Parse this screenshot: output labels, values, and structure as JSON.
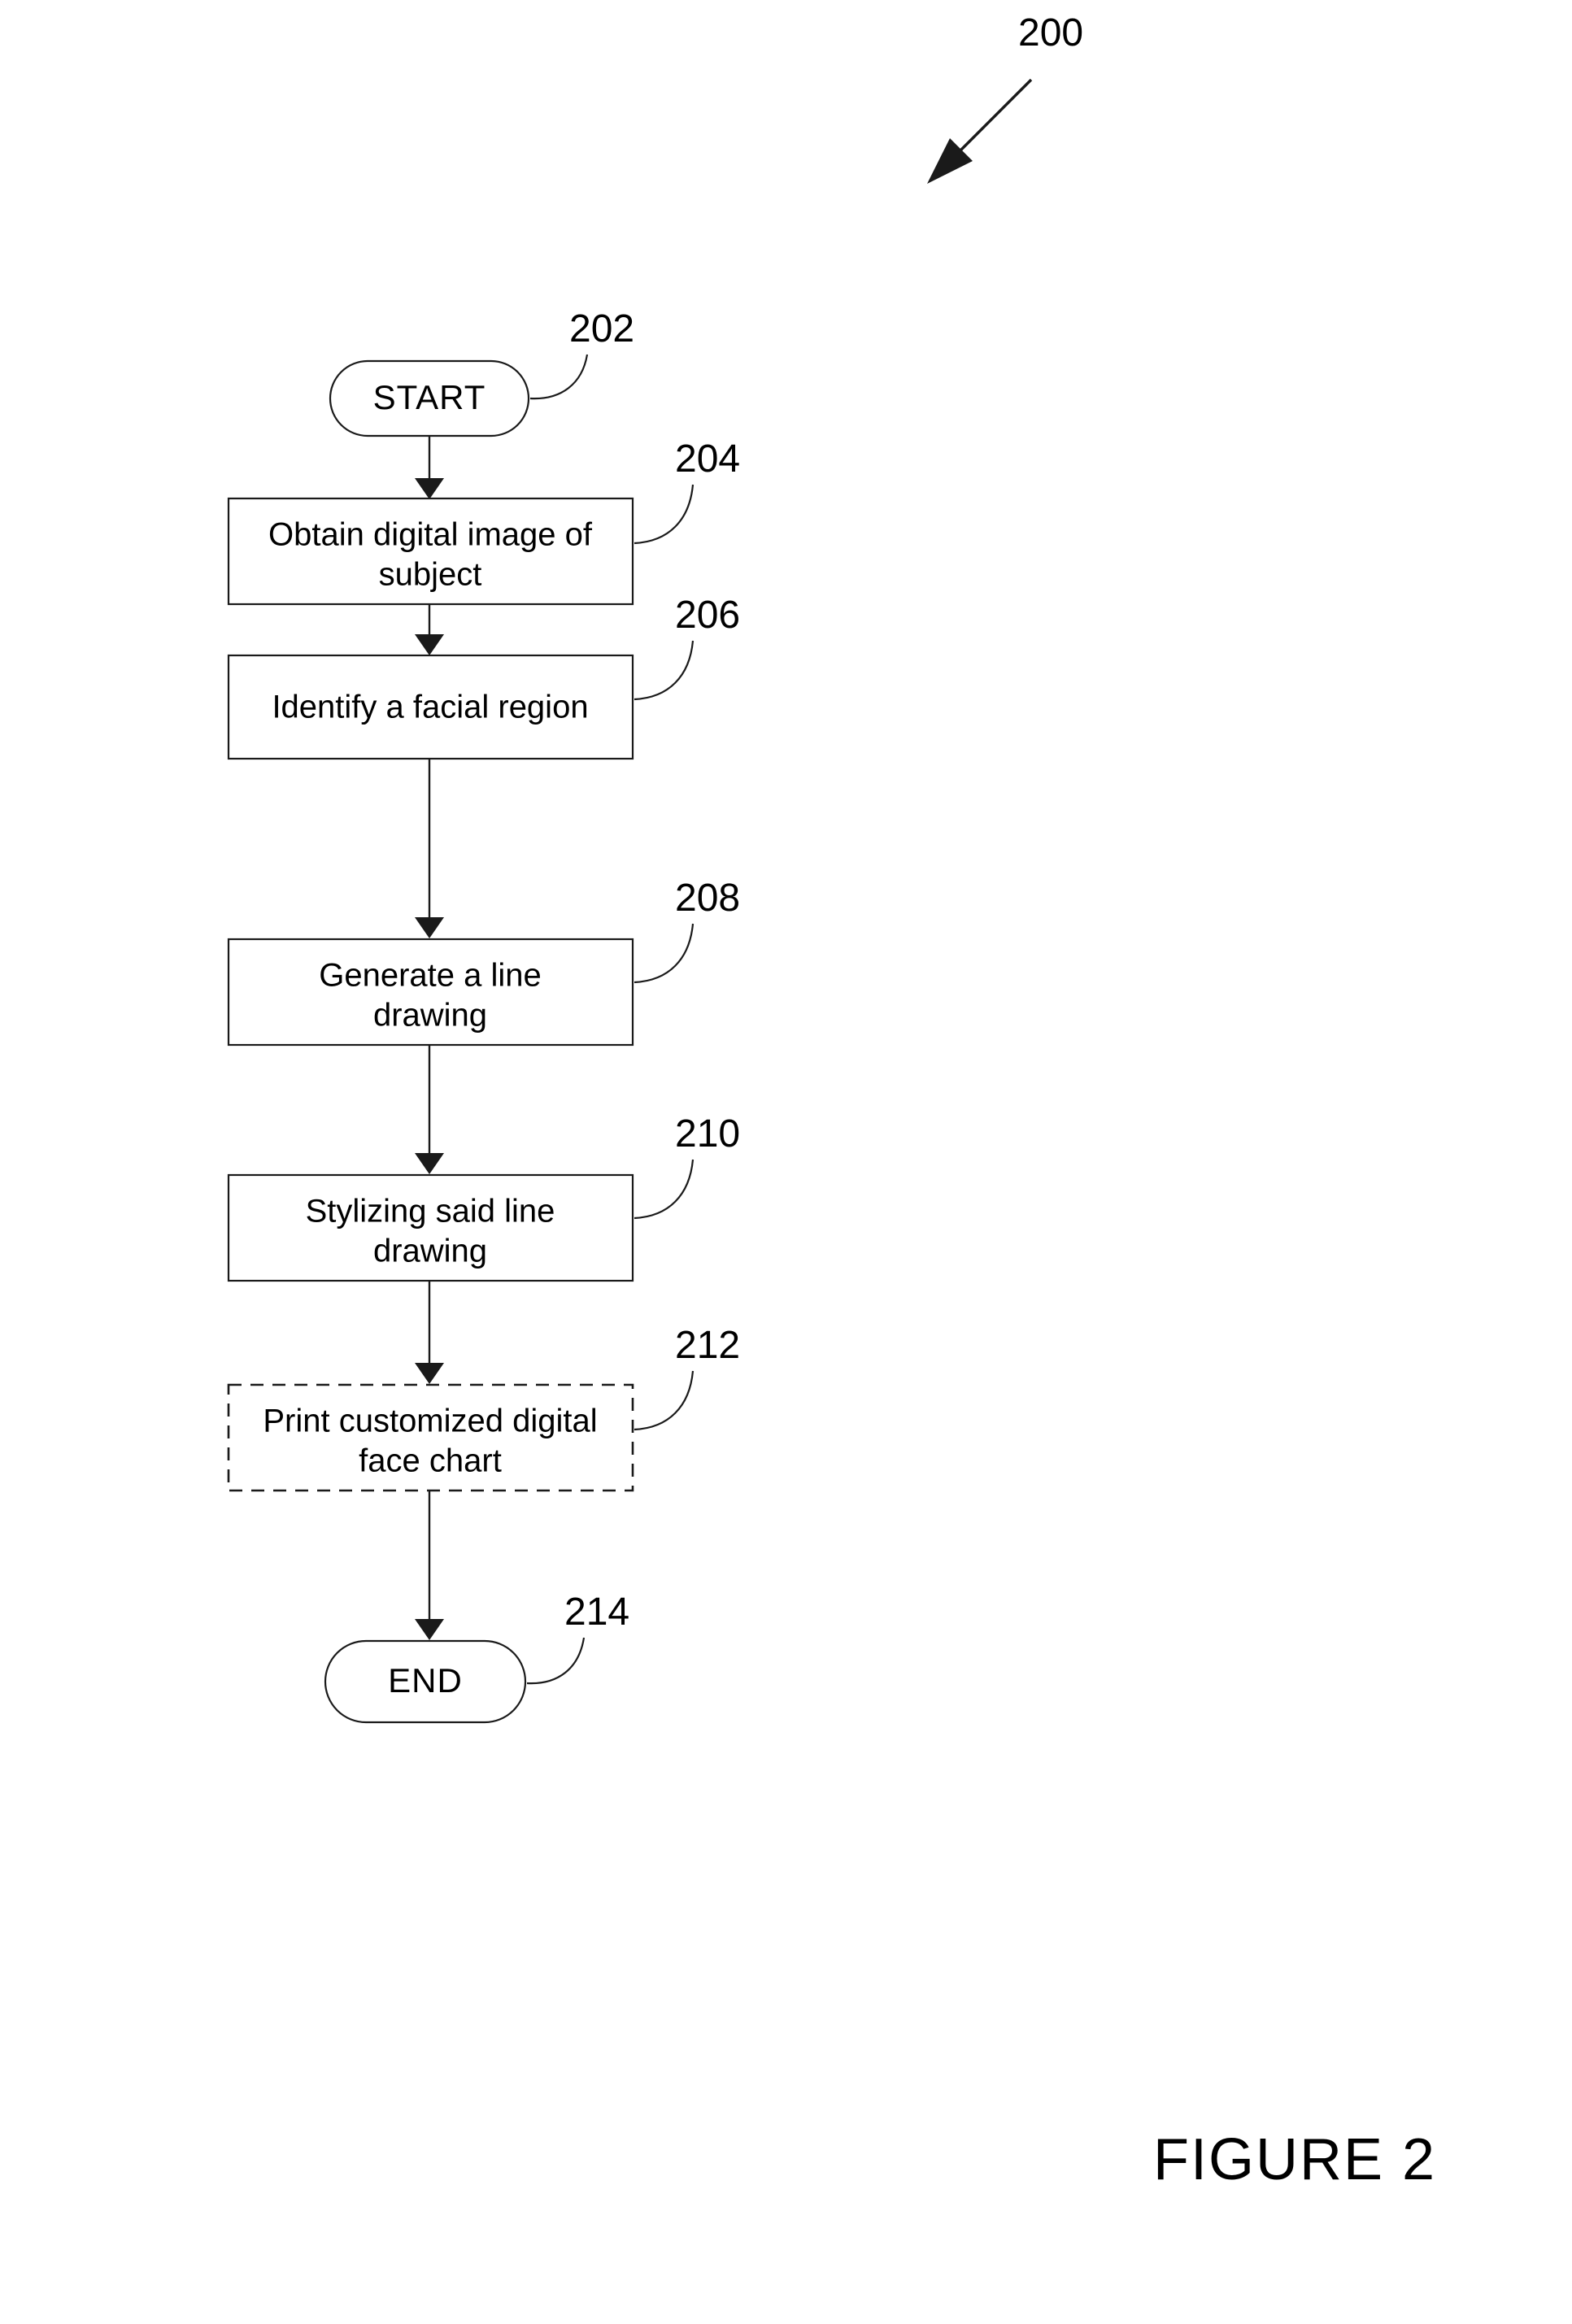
{
  "figure": {
    "caption": "FIGURE 2",
    "overall_ref": "200"
  },
  "flowchart": {
    "type": "process-flowchart",
    "orientation": "top-to-bottom",
    "nodes": [
      {
        "ref": "202",
        "shape": "terminal",
        "border": "solid",
        "label": "START",
        "lines": [
          "START"
        ]
      },
      {
        "ref": "204",
        "shape": "process",
        "border": "solid",
        "label": "Obtain digital image of subject",
        "lines": [
          "Obtain digital image of",
          "subject"
        ]
      },
      {
        "ref": "206",
        "shape": "process",
        "border": "solid",
        "label": "Identify a facial region",
        "lines": [
          "Identify a facial region"
        ]
      },
      {
        "ref": "208",
        "shape": "process",
        "border": "solid",
        "label": "Generate a line drawing",
        "lines": [
          "Generate a line",
          "drawing"
        ]
      },
      {
        "ref": "210",
        "shape": "process",
        "border": "solid",
        "label": "Stylizing said line drawing",
        "lines": [
          "Stylizing said line",
          "drawing"
        ]
      },
      {
        "ref": "212",
        "shape": "process-optional",
        "border": "dashed",
        "label": "Print customized digital face chart",
        "lines": [
          "Print customized digital",
          "face chart"
        ]
      },
      {
        "ref": "214",
        "shape": "terminal",
        "border": "solid",
        "label": "END",
        "lines": [
          "END"
        ]
      }
    ],
    "edges": [
      {
        "from": "202",
        "to": "204"
      },
      {
        "from": "204",
        "to": "206"
      },
      {
        "from": "206",
        "to": "208"
      },
      {
        "from": "208",
        "to": "210"
      },
      {
        "from": "210",
        "to": "212"
      },
      {
        "from": "212",
        "to": "214"
      }
    ]
  },
  "colors": {
    "ink": "#1a1a1a",
    "background": "#ffffff"
  }
}
